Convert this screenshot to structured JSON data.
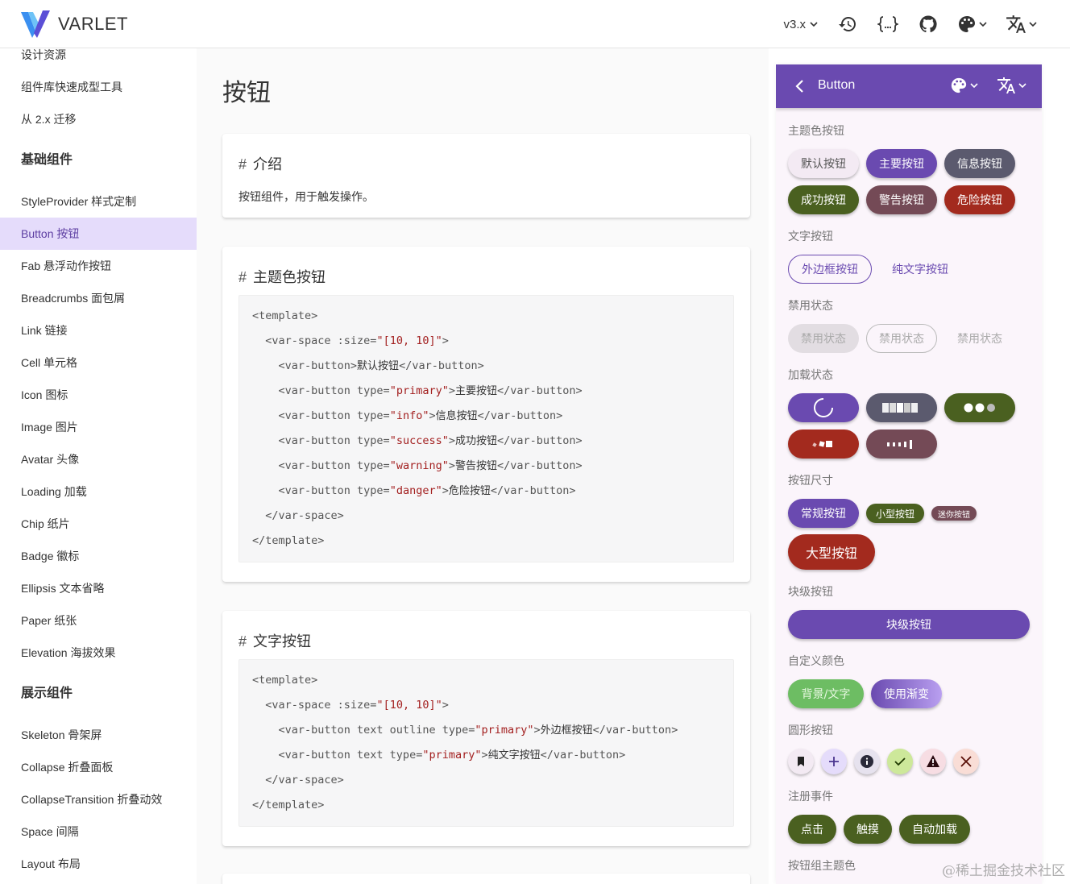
{
  "header": {
    "brand": "VARLET",
    "version": "v3.x",
    "icons": [
      "history-icon",
      "code-braces-icon",
      "github-icon",
      "palette-icon",
      "translate-icon"
    ]
  },
  "sidebar": {
    "items_top": [
      "设计资源",
      "组件库快速成型工具",
      "从 2.x 迁移"
    ],
    "group1": "基础组件",
    "group1_items": [
      "StyleProvider 样式定制",
      "Button 按钮",
      "Fab 悬浮动作按钮",
      "Breadcrumbs 面包屑",
      "Link 链接",
      "Cell 单元格",
      "Icon 图标",
      "Image 图片",
      "Avatar 头像",
      "Loading 加载",
      "Chip 纸片",
      "Badge 徽标",
      "Ellipsis 文本省略",
      "Paper 纸张",
      "Elevation 海拔效果"
    ],
    "active_item": "Button 按钮",
    "group2": "展示组件",
    "group2_items": [
      "Skeleton 骨架屏",
      "Collapse 折叠面板",
      "CollapseTransition 折叠动效",
      "Space 间隔",
      "Layout 布局"
    ]
  },
  "main": {
    "title": "按钮",
    "intro": {
      "hash": "#",
      "heading": "介绍",
      "text": "按钮组件，用于触发操作。"
    },
    "theme": {
      "hash": "#",
      "heading": "主题色按钮",
      "code": [
        "<template>",
        "  <var-space :size=\"[10, 10]\">",
        "    <var-button>默认按钮</var-button>",
        "    <var-button type=\"primary\">主要按钮</var-button>",
        "    <var-button type=\"info\">信息按钮</var-button>",
        "    <var-button type=\"success\">成功按钮</var-button>",
        "    <var-button type=\"warning\">警告按钮</var-button>",
        "    <var-button type=\"danger\">危险按钮</var-button>",
        "  </var-space>",
        "</template>"
      ]
    },
    "text_btn": {
      "hash": "#",
      "heading": "文字按钮",
      "code": [
        "<template>",
        "  <var-space :size=\"[10, 10]\">",
        "    <var-button text outline type=\"primary\">外边框按钮</var-button>",
        "    <var-button text type=\"primary\">纯文字按钮</var-button>",
        "  </var-space>",
        "</template>"
      ]
    }
  },
  "mobile": {
    "title": "Button",
    "sections": {
      "theme": "主题色按钮",
      "text": "文字按钮",
      "disabled": "禁用状态",
      "loading": "加载状态",
      "size": "按钮尺寸",
      "block": "块级按钮",
      "custom": "自定义颜色",
      "round": "圆形按钮",
      "events": "注册事件",
      "group": "按钮组主题色"
    },
    "theme_buttons": [
      "默认按钮",
      "主要按钮",
      "信息按钮",
      "成功按钮",
      "警告按钮",
      "危险按钮"
    ],
    "text_buttons": [
      "外边框按钮",
      "纯文字按钮"
    ],
    "disabled_buttons": [
      "禁用状态",
      "禁用状态",
      "禁用状态"
    ],
    "size_buttons": [
      "常规按钮",
      "小型按钮",
      "迷你按钮",
      "大型按钮"
    ],
    "block_button": "块级按钮",
    "custom_buttons": [
      "背景/文字",
      "使用渐变"
    ],
    "round_icons": [
      "bookmark-icon",
      "plus-icon",
      "info-icon",
      "check-icon",
      "warning-icon",
      "close-icon"
    ],
    "event_buttons": [
      "点击",
      "触摸",
      "自动加载"
    ]
  },
  "watermark": "@稀土掘金技术社区",
  "colors": {
    "primary": "#6a4ab0",
    "info": "#5b5a6e",
    "success": "#4a6020",
    "warning": "#744a56",
    "danger": "#a32a1e",
    "active_bg": "#e5dcfb"
  }
}
